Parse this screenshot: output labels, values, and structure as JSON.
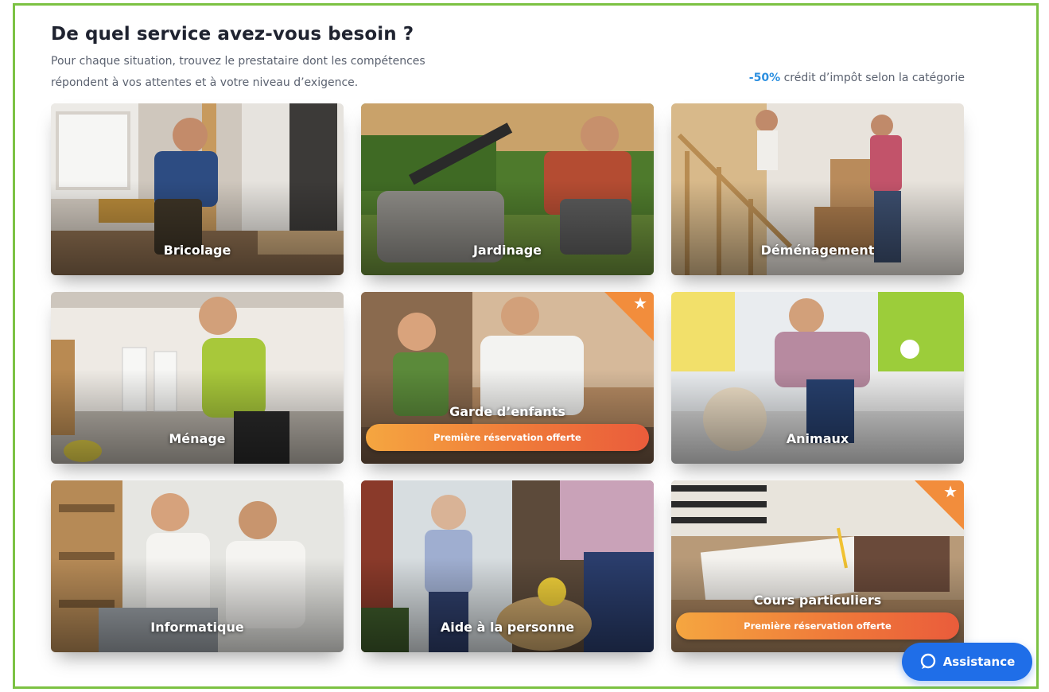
{
  "header": {
    "title": "De quel service avez-vous besoin ?",
    "subtitle_line1": "Pour chaque situation, trouvez le prestataire dont les compétences",
    "subtitle_line2": "répondent à vos attentes et à votre niveau d’exigence.",
    "tax_percent": "-50%",
    "tax_text": " crédit d’impôt selon la catégorie"
  },
  "services": [
    {
      "label": "Bricolage"
    },
    {
      "label": "Jardinage"
    },
    {
      "label": "Déménagement"
    },
    {
      "label": "Ménage"
    },
    {
      "label": "Garde d’enfants",
      "promo": "Première réservation offerte"
    },
    {
      "label": "Animaux"
    },
    {
      "label": "Informatique"
    },
    {
      "label": "Aide à la personne"
    },
    {
      "label": "Cours particuliers",
      "promo": "Première réservation offerte"
    }
  ],
  "assistance": {
    "label": "Assistance"
  },
  "colors": {
    "frame": "#7cc243",
    "accent_blue": "#2b8fe0",
    "promo_orange": "#ef7a3a",
    "assist_blue": "#1f6ee8"
  },
  "icons": {
    "ribbon": "star-icon",
    "assistance": "chat-bubble-icon"
  }
}
